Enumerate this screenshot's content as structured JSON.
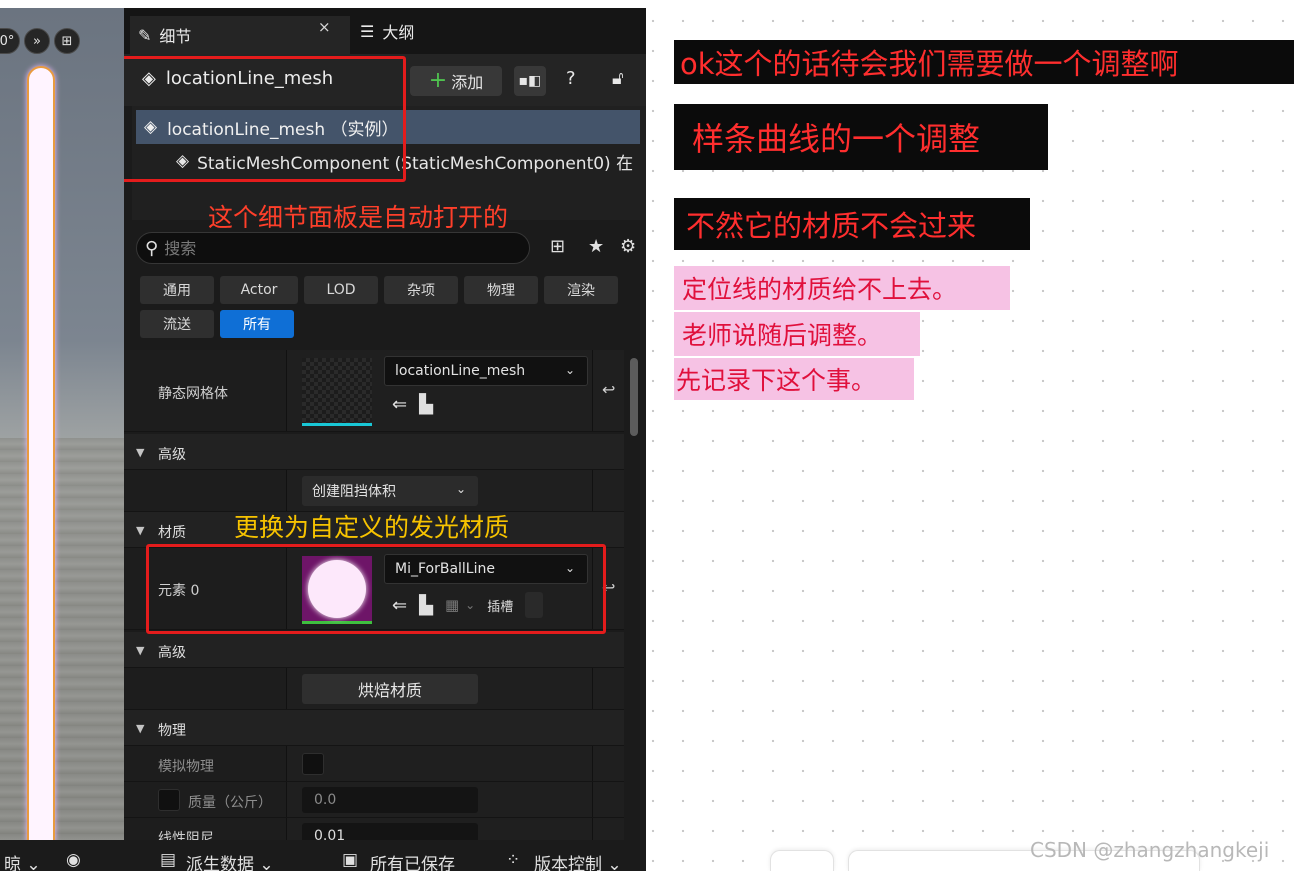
{
  "viewport": {
    "angle_btn": "0°",
    "more_btn": "»",
    "layout_btn": "⊞"
  },
  "tabs": {
    "details": "细节",
    "close": "×",
    "outline": "大纲"
  },
  "header": {
    "actor_name": "locationLine_mesh",
    "add_label": "添加"
  },
  "tree": {
    "root": "locationLine_mesh （实例）",
    "child": "StaticMeshComponent (StaticMeshComponent0) 在"
  },
  "search": {
    "placeholder": "搜索"
  },
  "filters": {
    "row1": [
      "通用",
      "Actor",
      "LOD",
      "杂项",
      "物理",
      "渲染"
    ],
    "row2": [
      "流送",
      "所有"
    ],
    "active": "所有"
  },
  "properties": {
    "static_mesh_label": "静态网格体",
    "static_mesh_value": "locationLine_mesh",
    "advanced1": "高级",
    "blocking_volume_btn": "创建阻挡体积",
    "material_section": "材质",
    "element_label": "元素 0",
    "material_value": "Mi_ForBallLine",
    "slot_label": "插槽",
    "advanced2": "高级",
    "bake_btn": "烘焙材质",
    "physics_section": "物理",
    "simulate_label": "模拟物理",
    "mass_label": "质量（公斤）",
    "mass_value": "0.0",
    "damping_label": "线性阻尼",
    "damping_value": "0.01"
  },
  "annotations": {
    "panel_auto_open": "这个细节面板是自动打开的",
    "replace_material": "更换为自定义的发光材质"
  },
  "bottom_bar": {
    "item1": "晾 ⌄",
    "item2": "派生数据 ⌄",
    "item3": "所有已保存",
    "item4": "版本控制 ⌄"
  },
  "notes": {
    "line1": "ok这个的话待会我们需要做一个调整啊",
    "line2": "样条曲线的一个调整",
    "line3": "不然它的材质不会过来",
    "pink1": "定位线的材质给不上去。",
    "pink2": "老师说随后调整。",
    "pink3": "先记录下这个事。"
  },
  "watermark": "CSDN @zhangzhangkeji",
  "colors": {
    "accent_blue": "#0f6fd6",
    "annotation_red": "#e41c1c",
    "annotation_yellow": "#f7c300",
    "note_pink": "#f6c2e4"
  }
}
